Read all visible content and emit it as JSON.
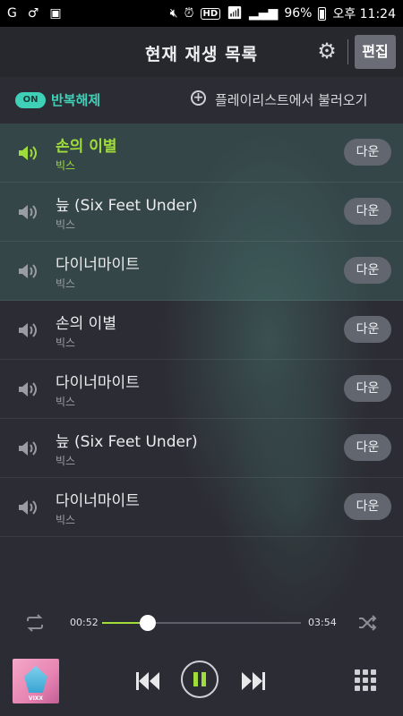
{
  "statusbar": {
    "left_icons": [
      "g-icon",
      "male-icon",
      "flipboard-icon"
    ],
    "hd": "HD",
    "battery": "96%",
    "time": "오후 11:24"
  },
  "header": {
    "title": "현재 재생 목록",
    "edit_label": "편집"
  },
  "subbar": {
    "on_label": "ON",
    "repeat_label": "반복해제",
    "load_playlist_label": "플레이리스트에서 불러오기"
  },
  "tracks": [
    {
      "title": "손의 이별",
      "artist": "빅스",
      "download": "다운",
      "state": "playing"
    },
    {
      "title": "늪 (Six Feet Under)",
      "artist": "빅스",
      "download": "다운",
      "state": "highlighted"
    },
    {
      "title": "다이너마이트",
      "artist": "빅스",
      "download": "다운",
      "state": "highlighted"
    },
    {
      "title": "손의 이별",
      "artist": "빅스",
      "download": "다운",
      "state": "normal"
    },
    {
      "title": "다이너마이트",
      "artist": "빅스",
      "download": "다운",
      "state": "normal"
    },
    {
      "title": "늪 (Six Feet Under)",
      "artist": "빅스",
      "download": "다운",
      "state": "normal"
    },
    {
      "title": "다이너마이트",
      "artist": "빅스",
      "download": "다운",
      "state": "normal"
    }
  ],
  "player": {
    "current_time": "00:52",
    "total_time": "03:54",
    "progress": 0.23,
    "album_text": "VIXX",
    "state": "playing"
  },
  "colors": {
    "accent_green": "#9fdd3a",
    "accent_teal": "#3fd1b8",
    "background": "#2c2d34"
  }
}
